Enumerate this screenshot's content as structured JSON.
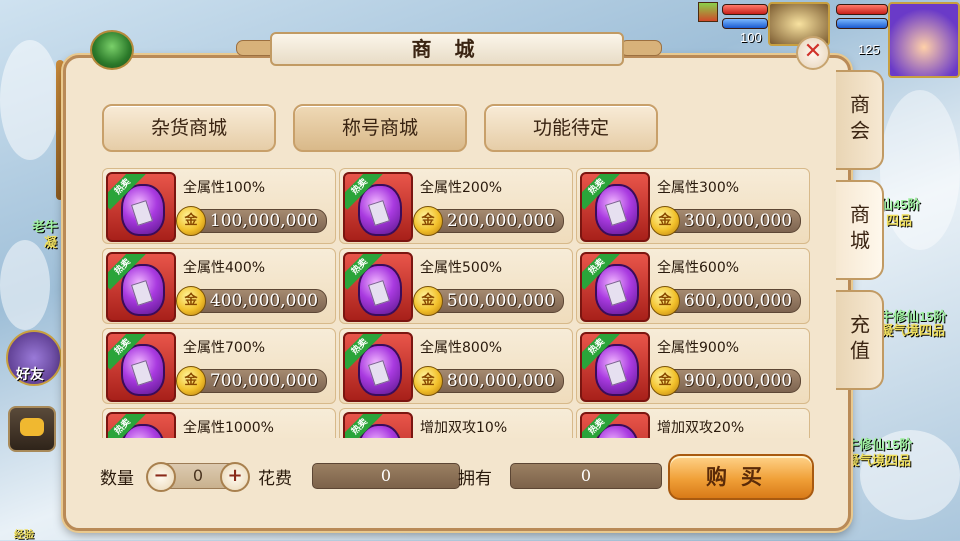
{
  "hud": {
    "level_a": "100",
    "level_b": "125"
  },
  "world": {
    "texts": [
      "老牛",
      "凝",
      "仙45阶",
      "四品",
      "牛修仙15阶",
      "凝气境四品",
      "牛修仙15阶",
      "凝气境四品",
      "经验"
    ],
    "friend_label": "好友"
  },
  "shop": {
    "title": "商 城",
    "close_label": "✕",
    "top_tabs": [
      "杂货商城",
      "称号商城",
      "功能待定"
    ],
    "side_tabs": [
      "商会",
      "商城",
      "充值"
    ],
    "hot_badge": "热卖",
    "coin_symbol": "金",
    "items": [
      {
        "name": "全属性100%",
        "price": "100,000,000"
      },
      {
        "name": "全属性200%",
        "price": "200,000,000"
      },
      {
        "name": "全属性300%",
        "price": "300,000,000"
      },
      {
        "name": "全属性400%",
        "price": "400,000,000"
      },
      {
        "name": "全属性500%",
        "price": "500,000,000"
      },
      {
        "name": "全属性600%",
        "price": "600,000,000"
      },
      {
        "name": "全属性700%",
        "price": "700,000,000"
      },
      {
        "name": "全属性800%",
        "price": "800,000,000"
      },
      {
        "name": "全属性900%",
        "price": "900,000,000"
      },
      {
        "name": "全属性1000%",
        "price": ""
      },
      {
        "name": "增加双攻10%",
        "price": ""
      },
      {
        "name": "增加双攻20%",
        "price": ""
      }
    ],
    "footer": {
      "qty_label": "数量",
      "qty_minus": "−",
      "qty_plus": "+",
      "qty_value": "0",
      "cost_label": "花费",
      "cost_value": "0",
      "own_label": "拥有",
      "own_value": "0",
      "buy_label": "购买"
    }
  }
}
